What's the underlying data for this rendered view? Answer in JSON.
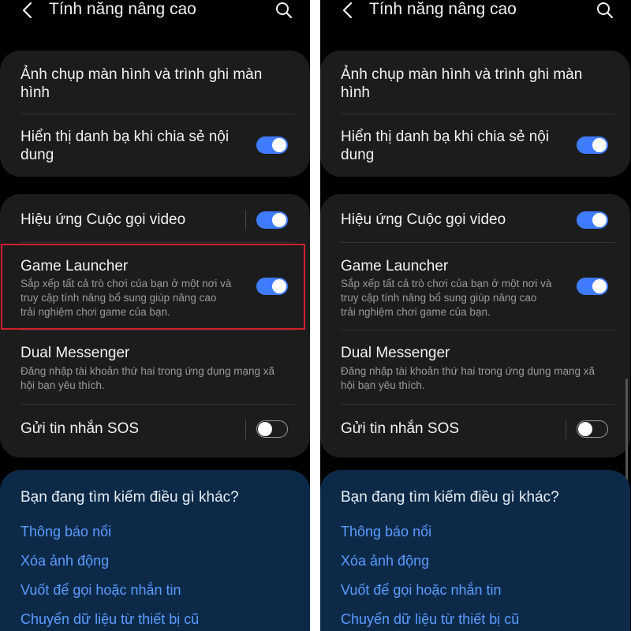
{
  "screens": [
    {
      "header": {
        "title": "Tính năng nâng cao"
      },
      "card1": {
        "item1": {
          "label_line1": "Ảnh chụp màn hình và trình ghi màn",
          "label_line2": "hình"
        },
        "item2": {
          "label_line1": "Hiển thị danh bạ khi chia sẻ nội",
          "label_line2": "dung",
          "toggle": "on"
        }
      },
      "card2": {
        "video": {
          "label": "Hiệu ứng Cuộc gọi video",
          "toggle": "on"
        },
        "game": {
          "label": "Game Launcher",
          "sub_line1": "Sắp xếp tất cả trò chơi của bạn ở một nơi và",
          "sub_line2": "truy cập tính năng bổ sung giúp nâng cao",
          "sub_line3": "trải nghiệm chơi game của bạn.",
          "toggle": "on"
        },
        "dual": {
          "label": "Dual Messenger",
          "sub_line1": "Đăng nhập tài khoản thứ hai trong ứng dụng mạng xã",
          "sub_line2": "hội bạn yêu thích."
        },
        "sos": {
          "label": "Gửi tin nhắn SOS",
          "toggle": "off"
        }
      },
      "suggest": {
        "title": "Bạn đang tìm kiếm điều gì khác?",
        "links": [
          "Thông báo nổi",
          "Xóa ảnh động",
          "Vuốt để gọi hoặc nhắn tin",
          "Chuyển dữ liệu từ thiết bị cũ"
        ]
      },
      "highlight_color": "#d0202a"
    },
    {
      "header": {
        "title": "Tính năng nâng cao"
      },
      "card1": {
        "item1": {
          "label_line1": "Ảnh chụp màn hình và trình ghi màn",
          "label_line2": "hình"
        },
        "item2": {
          "label_line1": "Hiển thị danh bạ khi chia sẻ nội",
          "label_line2": "dung",
          "toggle": "on"
        }
      },
      "card2": {
        "video": {
          "label": "Hiệu ứng Cuộc gọi video",
          "toggle": "on"
        },
        "game": {
          "label": "Game Launcher",
          "sub_line1": "Sắp xếp tất cả trò chơi của bạn ở một nơi và",
          "sub_line2": "truy cập tính năng bổ sung giúp nâng cao",
          "sub_line3": "trải nghiệm chơi game của bạn.",
          "toggle": "on"
        },
        "dual": {
          "label": "Dual Messenger",
          "sub_line1": "Đăng nhập tài khoản thứ hai trong ứng dụng mạng xã",
          "sub_line2": "hội bạn yêu thích."
        },
        "sos": {
          "label": "Gửi tin nhắn SOS",
          "toggle": "off"
        }
      },
      "suggest": {
        "title": "Bạn đang tìm kiếm điều gì khác?",
        "links": [
          "Thông báo nổi",
          "Xóa ảnh động",
          "Vuốt để gọi hoặc nhắn tin",
          "Chuyển dữ liệu từ thiết bị cũ"
        ]
      }
    }
  ],
  "colors": {
    "background": "#000000",
    "card": "#1c1c1c",
    "toggle_on": "#3e7bff",
    "suggest_bg": "#0c2a48",
    "link": "#5c9bff"
  },
  "icons": [
    "back-arrow-icon",
    "search-icon"
  ]
}
